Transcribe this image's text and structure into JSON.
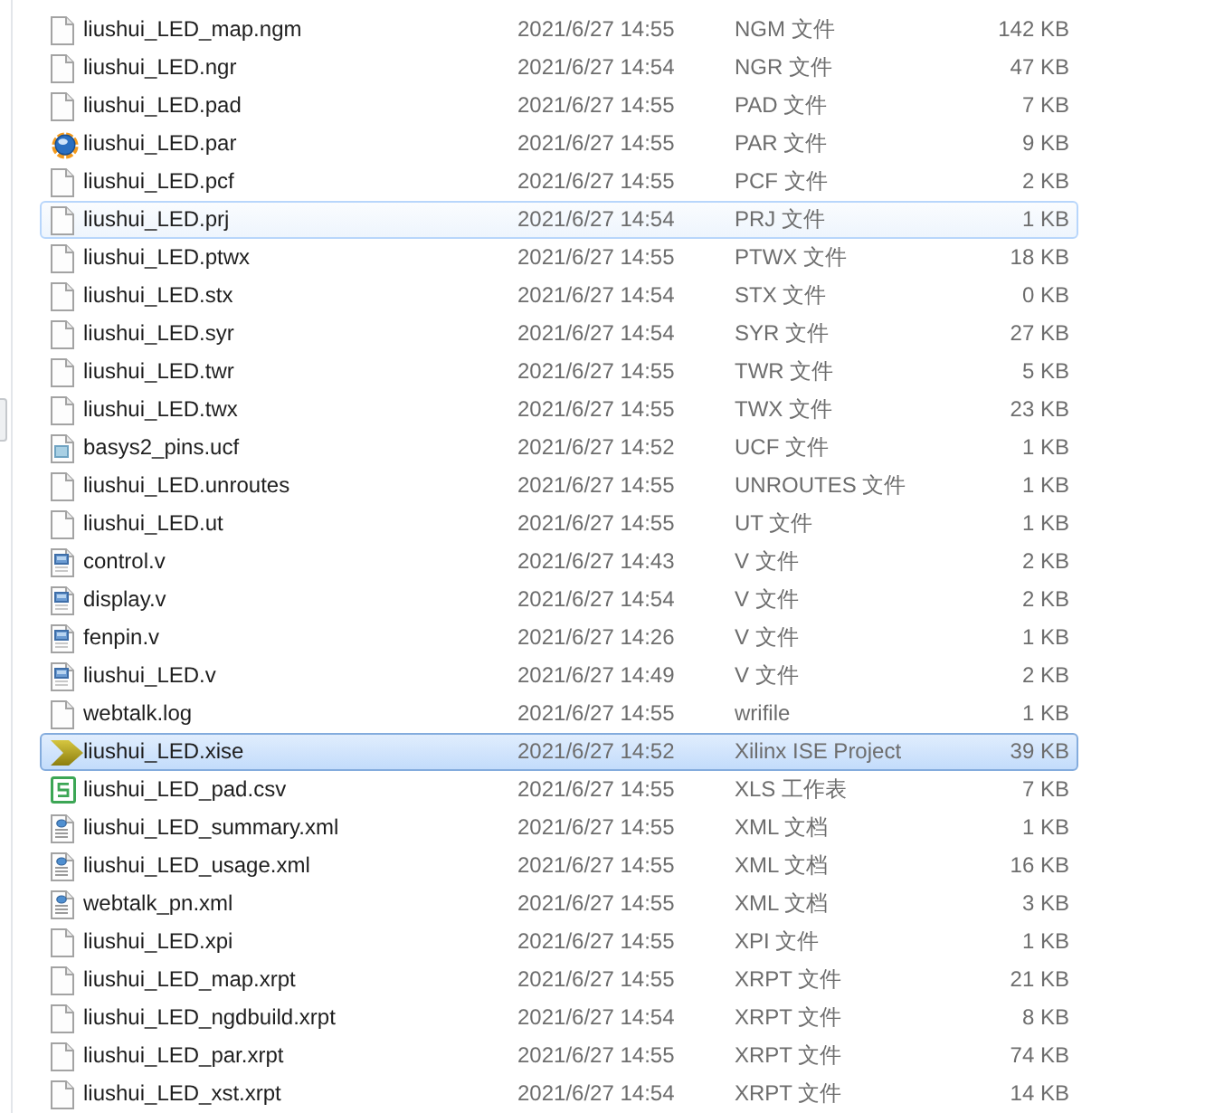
{
  "files": [
    {
      "name": "liushui_LED_map.ngm",
      "modified": "2021/6/27 14:55",
      "type": "NGM 文件",
      "size": "142 KB",
      "kind": "plain",
      "selected": false,
      "hovered": false
    },
    {
      "name": "liushui_LED.ngr",
      "modified": "2021/6/27 14:54",
      "type": "NGR 文件",
      "size": "47 KB",
      "kind": "plain",
      "selected": false,
      "hovered": false
    },
    {
      "name": "liushui_LED.pad",
      "modified": "2021/6/27 14:55",
      "type": "PAD 文件",
      "size": "7 KB",
      "kind": "plain",
      "selected": false,
      "hovered": false
    },
    {
      "name": "liushui_LED.par",
      "modified": "2021/6/27 14:55",
      "type": "PAR 文件",
      "size": "9 KB",
      "kind": "par",
      "selected": false,
      "hovered": false
    },
    {
      "name": "liushui_LED.pcf",
      "modified": "2021/6/27 14:55",
      "type": "PCF 文件",
      "size": "2 KB",
      "kind": "plain",
      "selected": false,
      "hovered": false
    },
    {
      "name": "liushui_LED.prj",
      "modified": "2021/6/27 14:54",
      "type": "PRJ 文件",
      "size": "1 KB",
      "kind": "plain",
      "selected": false,
      "hovered": true
    },
    {
      "name": "liushui_LED.ptwx",
      "modified": "2021/6/27 14:55",
      "type": "PTWX 文件",
      "size": "18 KB",
      "kind": "plain",
      "selected": false,
      "hovered": false
    },
    {
      "name": "liushui_LED.stx",
      "modified": "2021/6/27 14:54",
      "type": "STX 文件",
      "size": "0 KB",
      "kind": "plain",
      "selected": false,
      "hovered": false
    },
    {
      "name": "liushui_LED.syr",
      "modified": "2021/6/27 14:54",
      "type": "SYR 文件",
      "size": "27 KB",
      "kind": "plain",
      "selected": false,
      "hovered": false
    },
    {
      "name": "liushui_LED.twr",
      "modified": "2021/6/27 14:55",
      "type": "TWR 文件",
      "size": "5 KB",
      "kind": "plain",
      "selected": false,
      "hovered": false
    },
    {
      "name": "liushui_LED.twx",
      "modified": "2021/6/27 14:55",
      "type": "TWX 文件",
      "size": "23 KB",
      "kind": "plain",
      "selected": false,
      "hovered": false
    },
    {
      "name": "basys2_pins.ucf",
      "modified": "2021/6/27 14:52",
      "type": "UCF 文件",
      "size": "1 KB",
      "kind": "ucf",
      "selected": false,
      "hovered": false
    },
    {
      "name": "liushui_LED.unroutes",
      "modified": "2021/6/27 14:55",
      "type": "UNROUTES 文件",
      "size": "1 KB",
      "kind": "plain",
      "selected": false,
      "hovered": false
    },
    {
      "name": "liushui_LED.ut",
      "modified": "2021/6/27 14:55",
      "type": "UT 文件",
      "size": "1 KB",
      "kind": "plain",
      "selected": false,
      "hovered": false
    },
    {
      "name": "control.v",
      "modified": "2021/6/27 14:43",
      "type": "V 文件",
      "size": "2 KB",
      "kind": "verilog",
      "selected": false,
      "hovered": false
    },
    {
      "name": "display.v",
      "modified": "2021/6/27 14:54",
      "type": "V 文件",
      "size": "2 KB",
      "kind": "verilog",
      "selected": false,
      "hovered": false
    },
    {
      "name": "fenpin.v",
      "modified": "2021/6/27 14:26",
      "type": "V 文件",
      "size": "1 KB",
      "kind": "verilog",
      "selected": false,
      "hovered": false
    },
    {
      "name": "liushui_LED.v",
      "modified": "2021/6/27 14:49",
      "type": "V 文件",
      "size": "2 KB",
      "kind": "verilog",
      "selected": false,
      "hovered": false
    },
    {
      "name": "webtalk.log",
      "modified": "2021/6/27 14:55",
      "type": "wrifile",
      "size": "1 KB",
      "kind": "plain",
      "selected": false,
      "hovered": false
    },
    {
      "name": "liushui_LED.xise",
      "modified": "2021/6/27 14:52",
      "type": "Xilinx ISE Project",
      "size": "39 KB",
      "kind": "xise",
      "selected": true,
      "hovered": false
    },
    {
      "name": "liushui_LED_pad.csv",
      "modified": "2021/6/27 14:55",
      "type": "XLS 工作表",
      "size": "7 KB",
      "kind": "spreadsheet",
      "selected": false,
      "hovered": false
    },
    {
      "name": "liushui_LED_summary.xml",
      "modified": "2021/6/27 14:55",
      "type": "XML 文档",
      "size": "1 KB",
      "kind": "xml",
      "selected": false,
      "hovered": false
    },
    {
      "name": "liushui_LED_usage.xml",
      "modified": "2021/6/27 14:55",
      "type": "XML 文档",
      "size": "16 KB",
      "kind": "xml",
      "selected": false,
      "hovered": false
    },
    {
      "name": "webtalk_pn.xml",
      "modified": "2021/6/27 14:55",
      "type": "XML 文档",
      "size": "3 KB",
      "kind": "xml",
      "selected": false,
      "hovered": false
    },
    {
      "name": "liushui_LED.xpi",
      "modified": "2021/6/27 14:55",
      "type": "XPI 文件",
      "size": "1 KB",
      "kind": "plain",
      "selected": false,
      "hovered": false
    },
    {
      "name": "liushui_LED_map.xrpt",
      "modified": "2021/6/27 14:55",
      "type": "XRPT 文件",
      "size": "21 KB",
      "kind": "plain",
      "selected": false,
      "hovered": false
    },
    {
      "name": "liushui_LED_ngdbuild.xrpt",
      "modified": "2021/6/27 14:54",
      "type": "XRPT 文件",
      "size": "8 KB",
      "kind": "plain",
      "selected": false,
      "hovered": false
    },
    {
      "name": "liushui_LED_par.xrpt",
      "modified": "2021/6/27 14:55",
      "type": "XRPT 文件",
      "size": "74 KB",
      "kind": "plain",
      "selected": false,
      "hovered": false
    },
    {
      "name": "liushui_LED_xst.xrpt",
      "modified": "2021/6/27 14:54",
      "type": "XRPT 文件",
      "size": "14 KB",
      "kind": "plain",
      "selected": false,
      "hovered": false
    }
  ]
}
